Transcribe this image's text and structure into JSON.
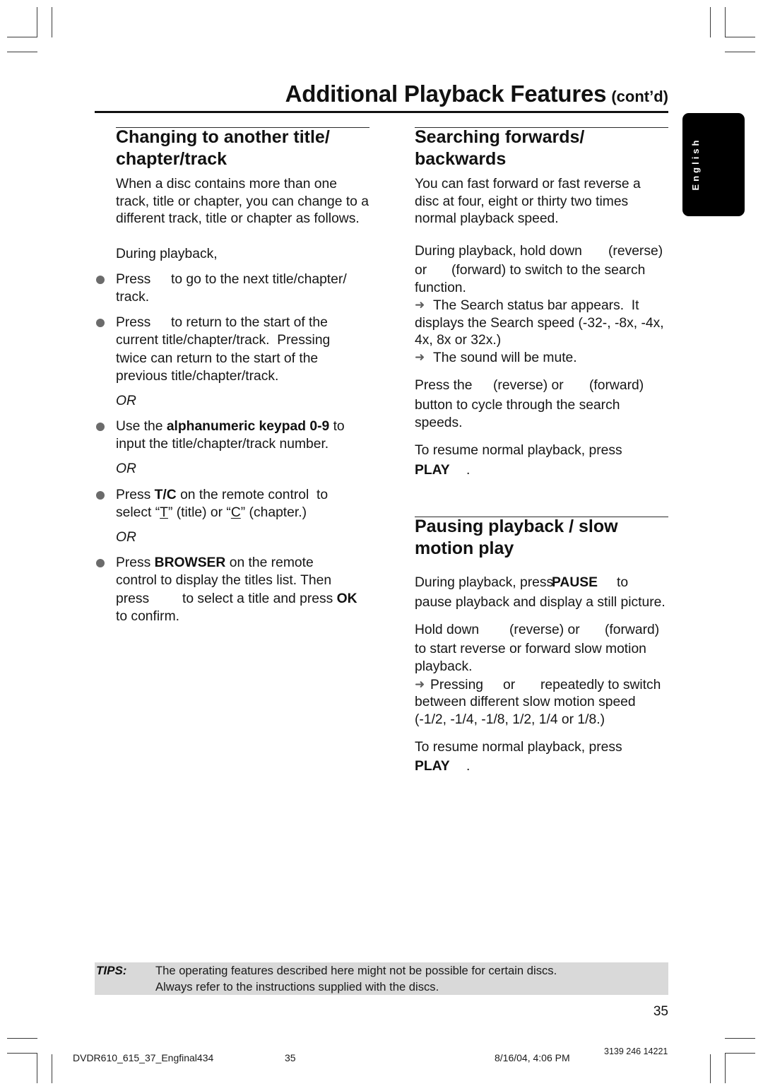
{
  "page_header": {
    "title": "Additional Playback Features",
    "suffix": "(cont’d)"
  },
  "language_tab": {
    "label": "English"
  },
  "changing_section": {
    "heading": [
      "Changing to another title/",
      "chapter/track"
    ],
    "intro": [
      "When a disc contains more than one",
      "track, title or chapter, you can change to a",
      "different track, title or chapter as follows."
    ],
    "during_playback": "During playback,",
    "or_separator": "OR",
    "bullet_1": [
      [
        "Press",
        "to go to the next title/chapter/"
      ],
      [
        "track."
      ]
    ],
    "bullet_2": [
      [
        "Press",
        "to return to the start of the"
      ],
      [
        "current title/chapter/track.  Pressing"
      ],
      [
        "twice can return to the start of the"
      ],
      [
        "previous title/chapter/track."
      ]
    ],
    "bullet_3": [
      [
        "Use the ",
        "alphanumeric keypad 0-9",
        " to"
      ],
      [
        "input the title/chapter/track number."
      ]
    ],
    "bullet_4": [
      [
        "Press ",
        "T/C",
        " on the remote control  to"
      ],
      [
        "select “",
        "T",
        "” (title) or “",
        "C",
        "” (chapter.)"
      ]
    ],
    "bullet_5": [
      [
        "Press ",
        "BROWSER",
        " on the remote"
      ],
      [
        "control to display the titles list. Then"
      ],
      [
        "press",
        "to select a title and press ",
        "OK"
      ],
      [
        "to confirm."
      ]
    ]
  },
  "searching_section": {
    "heading": [
      "Searching forwards/",
      "backwards"
    ],
    "intro": [
      "You can fast forward or fast reverse a",
      "disc at four, eight or thirty two times",
      "normal playback speed."
    ],
    "hold_down": [
      [
        "During playback, hold down",
        "(reverse)"
      ],
      [
        "or",
        "(forward) to switch to the search"
      ],
      [
        "function."
      ]
    ],
    "result_1": {
      "arrow": "➜",
      "lines": [
        "The Search status bar appears.  It",
        "displays the Search speed (-32-, -8x, -4x,",
        "4x, 8x or 32x.)"
      ]
    },
    "result_2": {
      "arrow": "➜",
      "lines": [
        "The sound will be mute."
      ]
    },
    "cycle": [
      [
        "Press the",
        "(reverse) or",
        "(forward)"
      ],
      [
        "button to cycle through the search"
      ],
      [
        "speeds."
      ]
    ],
    "resume": {
      "text": "To resume normal playback, press",
      "key": "PLAY",
      "end": "."
    }
  },
  "pausing_section": {
    "heading": [
      "Pausing playback / slow",
      "motion play"
    ],
    "pause": [
      [
        "During playback, press ",
        "PAUSE",
        "to"
      ],
      [
        "pause playback and display a still picture."
      ]
    ],
    "slow": [
      [
        "Hold down",
        "(reverse) or",
        "(forward)"
      ],
      [
        "to start reverse or forward slow motion"
      ],
      [
        "playback."
      ]
    ],
    "result": {
      "arrow": "➜",
      "lines": [
        [
          "Pressing",
          "or",
          "repeatedly to switch"
        ],
        [
          "between different slow motion speed"
        ],
        [
          "(-1/2, -1/4, -1/8, 1/2, 1/4 or 1/8.)"
        ]
      ]
    },
    "resume": {
      "text": "To resume normal playback, press",
      "key": "PLAY",
      "end": "."
    }
  },
  "tips": {
    "label": "TIPS:",
    "lines": [
      "The operating features described here might not be possible for certain discs.",
      "Always refer to the instructions supplied with the discs."
    ]
  },
  "page_number": "35",
  "print_footer": {
    "file_name": "DVDR610_615_37_Engfinal434",
    "page": "35",
    "timestamp": "8/16/04, 4:06 PM",
    "code": "3139 246 14221"
  }
}
